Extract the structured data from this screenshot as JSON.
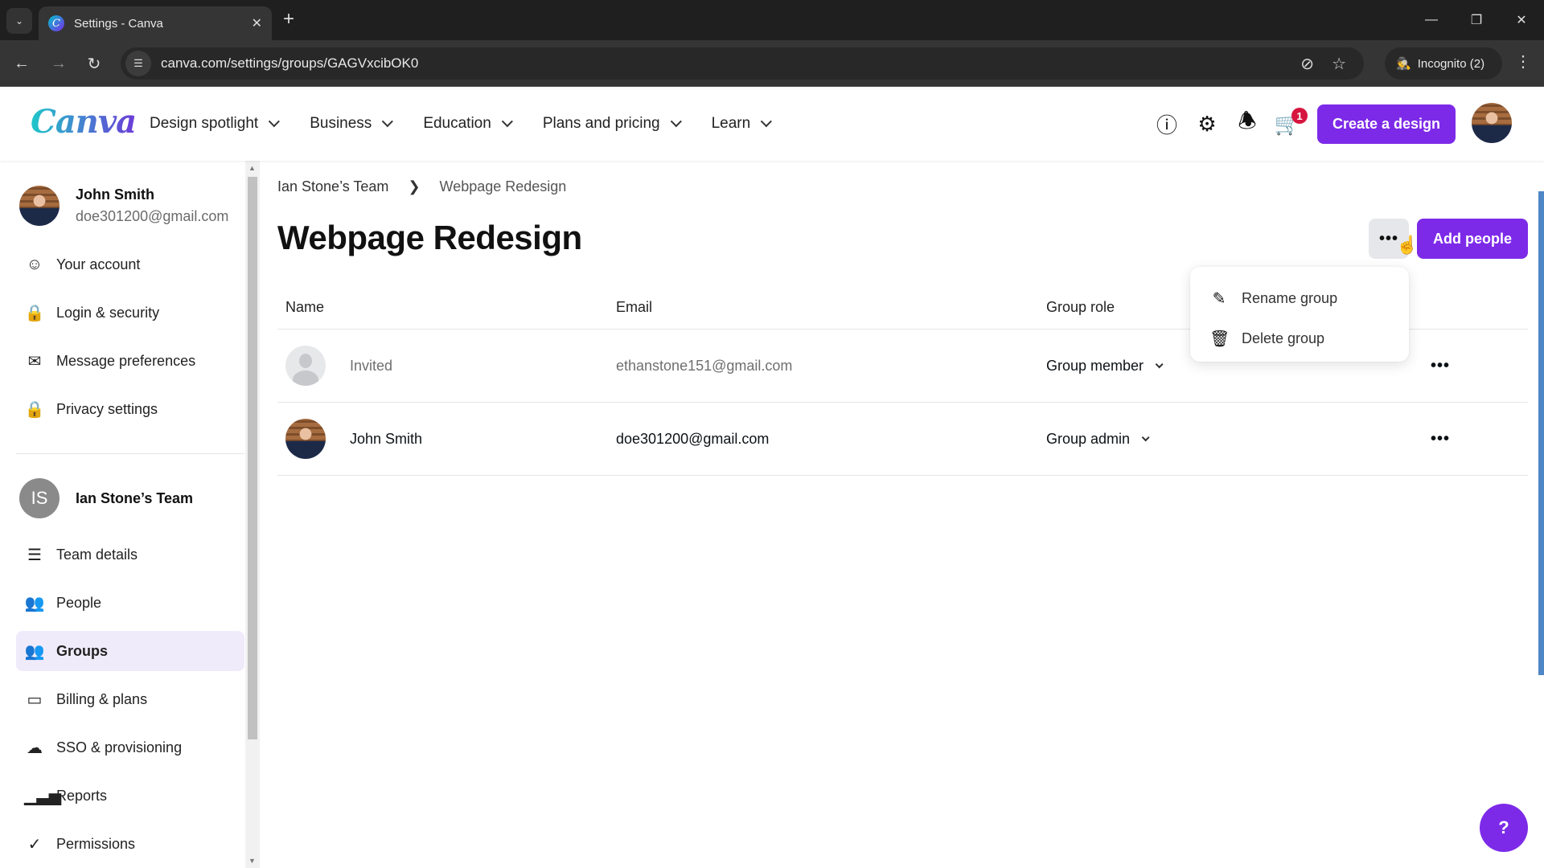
{
  "browser": {
    "tab_title": "Settings - Canva",
    "url": "canva.com/settings/groups/GAGVxcibOK0",
    "profile_label": "Incognito (2)"
  },
  "header": {
    "logo": "Canva",
    "nav": [
      {
        "label": "Design spotlight"
      },
      {
        "label": "Business"
      },
      {
        "label": "Education"
      },
      {
        "label": "Plans and pricing"
      },
      {
        "label": "Learn"
      }
    ],
    "cart_count": "1",
    "create_label": "Create a design",
    "accent_color": "#7d2ae8"
  },
  "sidebar": {
    "user": {
      "name": "John Smith",
      "email": "doe301200@gmail.com"
    },
    "account_items": [
      {
        "label": "Your account",
        "icon": "user-circle-icon"
      },
      {
        "label": "Login & security",
        "icon": "lock-icon"
      },
      {
        "label": "Message preferences",
        "icon": "envelope-icon"
      },
      {
        "label": "Privacy settings",
        "icon": "lock-icon"
      }
    ],
    "team": {
      "initials": "IS",
      "name": "Ian Stone’s Team"
    },
    "team_items": [
      {
        "label": "Team details",
        "icon": "list-icon"
      },
      {
        "label": "People",
        "icon": "add-people-icon"
      },
      {
        "label": "Groups",
        "icon": "groups-icon",
        "active": true
      },
      {
        "label": "Billing & plans",
        "icon": "credit-card-icon"
      },
      {
        "label": "SSO & provisioning",
        "icon": "cloud-lock-icon"
      },
      {
        "label": "Reports",
        "icon": "bar-chart-icon"
      },
      {
        "label": "Permissions",
        "icon": "check-circle-icon"
      }
    ]
  },
  "main": {
    "breadcrumb": [
      "Ian Stone’s Team",
      "Webpage Redesign"
    ],
    "title": "Webpage Redesign",
    "add_people_label": "Add people",
    "table": {
      "headers": [
        "Name",
        "Email",
        "Group role"
      ],
      "rows": [
        {
          "name": "Invited",
          "email": "ethanstone151@gmail.com",
          "role": "Group member",
          "pending": true
        },
        {
          "name": "John Smith",
          "email": "doe301200@gmail.com",
          "role": "Group admin",
          "pending": false
        }
      ]
    },
    "menu": [
      {
        "label": "Rename group",
        "icon": "pencil-icon"
      },
      {
        "label": "Delete group",
        "icon": "trash-icon"
      }
    ]
  },
  "help_label": "?"
}
